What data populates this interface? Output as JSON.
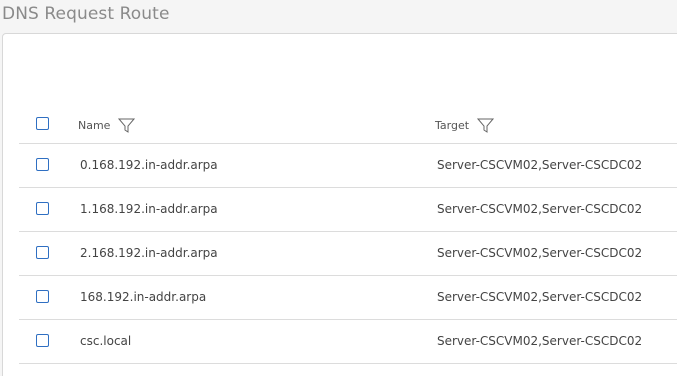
{
  "page": {
    "title": "DNS Request Route"
  },
  "table": {
    "columns": {
      "name": "Name",
      "target": "Target"
    },
    "rows": [
      {
        "name": "0.168.192.in-addr.arpa",
        "target": "Server-CSCVM02,Server-CSCDC02"
      },
      {
        "name": "1.168.192.in-addr.arpa",
        "target": "Server-CSCVM02,Server-CSCDC02"
      },
      {
        "name": "2.168.192.in-addr.arpa",
        "target": "Server-CSCVM02,Server-CSCDC02"
      },
      {
        "name": "168.192.in-addr.arpa",
        "target": "Server-CSCVM02,Server-CSCDC02"
      },
      {
        "name": "csc.local",
        "target": "Server-CSCVM02,Server-CSCDC02"
      }
    ]
  },
  "icons": {
    "filter": "filter-icon"
  },
  "colors": {
    "checkbox": "#2f6fc2",
    "title": "#8a8a8a"
  }
}
